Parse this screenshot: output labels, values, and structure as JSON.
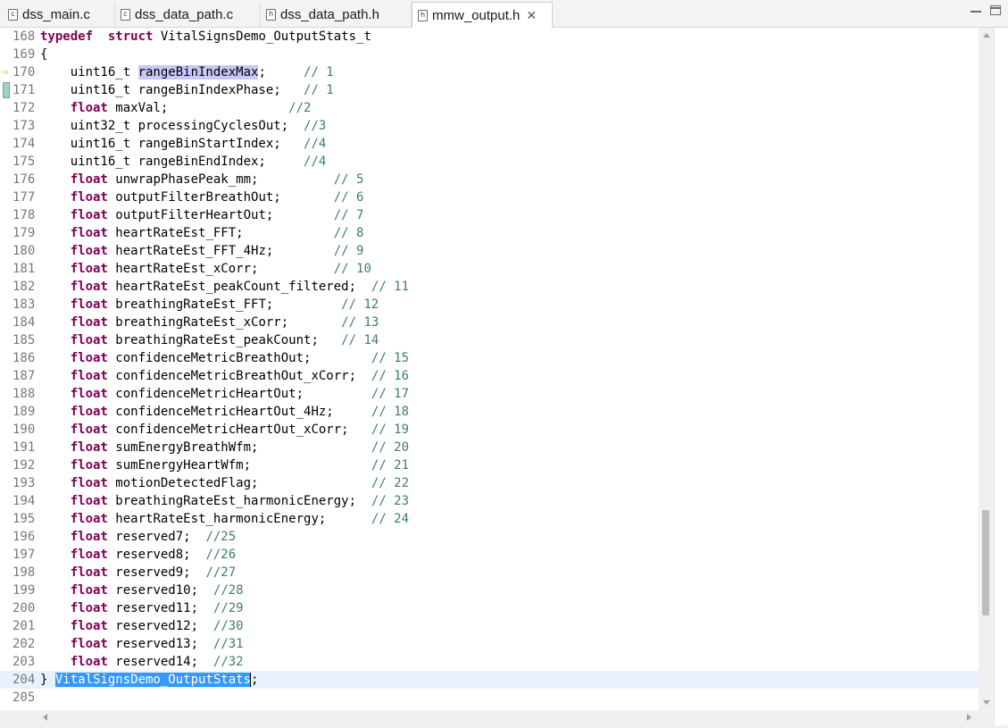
{
  "tabs": [
    {
      "label": "dss_main.c",
      "icon": "c-file-icon",
      "glyph": "c",
      "active": false
    },
    {
      "label": "dss_data_path.c",
      "icon": "c-file-icon",
      "glyph": "c",
      "active": false
    },
    {
      "label": "dss_data_path.h",
      "icon": "h-file-icon",
      "glyph": "h",
      "active": false
    },
    {
      "label": "mmw_output.h",
      "icon": "h-file-icon",
      "glyph": "h",
      "active": true,
      "close": "✕"
    }
  ],
  "editor": {
    "lines": [
      {
        "num": "168",
        "segs": [
          [
            "kw",
            "typedef"
          ],
          [
            "",
            "  "
          ],
          [
            "kw",
            "struct"
          ],
          [
            "",
            " VitalSignsDemo_OutputStats_t"
          ]
        ]
      },
      {
        "num": "169",
        "segs": [
          [
            "",
            "{"
          ]
        ]
      },
      {
        "num": "170",
        "marker": "arrow",
        "segs": [
          [
            "",
            "    uint16_t "
          ],
          [
            "occ",
            "rangeBinIndexMax"
          ],
          [
            "",
            ";     "
          ],
          [
            "cm",
            "// 1"
          ]
        ]
      },
      {
        "num": "171",
        "marker": "change",
        "segs": [
          [
            "",
            "    uint16_t rangeBinIndexPhase;   "
          ],
          [
            "cm",
            "// 1"
          ]
        ]
      },
      {
        "num": "172",
        "segs": [
          [
            "",
            "    "
          ],
          [
            "kw",
            "float"
          ],
          [
            "",
            " maxVal;                "
          ],
          [
            "cm",
            "//2"
          ]
        ]
      },
      {
        "num": "173",
        "segs": [
          [
            "",
            "    uint32_t processingCyclesOut;  "
          ],
          [
            "cm",
            "//3"
          ]
        ]
      },
      {
        "num": "174",
        "segs": [
          [
            "",
            "    uint16_t rangeBinStartIndex;   "
          ],
          [
            "cm",
            "//4"
          ]
        ]
      },
      {
        "num": "175",
        "segs": [
          [
            "",
            "    uint16_t rangeBinEndIndex;     "
          ],
          [
            "cm",
            "//4"
          ]
        ]
      },
      {
        "num": "176",
        "segs": [
          [
            "",
            "    "
          ],
          [
            "kw",
            "float"
          ],
          [
            "",
            " unwrapPhasePeak_mm;          "
          ],
          [
            "cm",
            "// 5"
          ]
        ]
      },
      {
        "num": "177",
        "segs": [
          [
            "",
            "    "
          ],
          [
            "kw",
            "float"
          ],
          [
            "",
            " outputFilterBreathOut;       "
          ],
          [
            "cm",
            "// 6"
          ]
        ]
      },
      {
        "num": "178",
        "segs": [
          [
            "",
            "    "
          ],
          [
            "kw",
            "float"
          ],
          [
            "",
            " outputFilterHeartOut;        "
          ],
          [
            "cm",
            "// 7"
          ]
        ]
      },
      {
        "num": "179",
        "segs": [
          [
            "",
            "    "
          ],
          [
            "kw",
            "float"
          ],
          [
            "",
            " heartRateEst_FFT;            "
          ],
          [
            "cm",
            "// 8"
          ]
        ]
      },
      {
        "num": "180",
        "segs": [
          [
            "",
            "    "
          ],
          [
            "kw",
            "float"
          ],
          [
            "",
            " heartRateEst_FFT_4Hz;        "
          ],
          [
            "cm",
            "// 9"
          ]
        ]
      },
      {
        "num": "181",
        "segs": [
          [
            "",
            "    "
          ],
          [
            "kw",
            "float"
          ],
          [
            "",
            " heartRateEst_xCorr;          "
          ],
          [
            "cm",
            "// 10"
          ]
        ]
      },
      {
        "num": "182",
        "segs": [
          [
            "",
            "    "
          ],
          [
            "kw",
            "float"
          ],
          [
            "",
            " heartRateEst_peakCount_filtered;  "
          ],
          [
            "cm",
            "// 11"
          ]
        ]
      },
      {
        "num": "183",
        "segs": [
          [
            "",
            "    "
          ],
          [
            "kw",
            "float"
          ],
          [
            "",
            " breathingRateEst_FFT;         "
          ],
          [
            "cm",
            "// 12"
          ]
        ]
      },
      {
        "num": "184",
        "segs": [
          [
            "",
            "    "
          ],
          [
            "kw",
            "float"
          ],
          [
            "",
            " breathingRateEst_xCorr;       "
          ],
          [
            "cm",
            "// 13"
          ]
        ]
      },
      {
        "num": "185",
        "segs": [
          [
            "",
            "    "
          ],
          [
            "kw",
            "float"
          ],
          [
            "",
            " breathingRateEst_peakCount;   "
          ],
          [
            "cm",
            "// 14"
          ]
        ]
      },
      {
        "num": "186",
        "segs": [
          [
            "",
            "    "
          ],
          [
            "kw",
            "float"
          ],
          [
            "",
            " confidenceMetricBreathOut;        "
          ],
          [
            "cm",
            "// 15"
          ]
        ]
      },
      {
        "num": "187",
        "segs": [
          [
            "",
            "    "
          ],
          [
            "kw",
            "float"
          ],
          [
            "",
            " confidenceMetricBreathOut_xCorr;  "
          ],
          [
            "cm",
            "// 16"
          ]
        ]
      },
      {
        "num": "188",
        "segs": [
          [
            "",
            "    "
          ],
          [
            "kw",
            "float"
          ],
          [
            "",
            " confidenceMetricHeartOut;         "
          ],
          [
            "cm",
            "// 17"
          ]
        ]
      },
      {
        "num": "189",
        "segs": [
          [
            "",
            "    "
          ],
          [
            "kw",
            "float"
          ],
          [
            "",
            " confidenceMetricHeartOut_4Hz;     "
          ],
          [
            "cm",
            "// 18"
          ]
        ]
      },
      {
        "num": "190",
        "segs": [
          [
            "",
            "    "
          ],
          [
            "kw",
            "float"
          ],
          [
            "",
            " confidenceMetricHeartOut_xCorr;   "
          ],
          [
            "cm",
            "// 19"
          ]
        ]
      },
      {
        "num": "191",
        "segs": [
          [
            "",
            "    "
          ],
          [
            "kw",
            "float"
          ],
          [
            "",
            " sumEnergyBreathWfm;               "
          ],
          [
            "cm",
            "// 20"
          ]
        ]
      },
      {
        "num": "192",
        "segs": [
          [
            "",
            "    "
          ],
          [
            "kw",
            "float"
          ],
          [
            "",
            " sumEnergyHeartWfm;                "
          ],
          [
            "cm",
            "// 21"
          ]
        ]
      },
      {
        "num": "193",
        "segs": [
          [
            "",
            "    "
          ],
          [
            "kw",
            "float"
          ],
          [
            "",
            " motionDetectedFlag;               "
          ],
          [
            "cm",
            "// 22"
          ]
        ]
      },
      {
        "num": "194",
        "segs": [
          [
            "",
            "    "
          ],
          [
            "kw",
            "float"
          ],
          [
            "",
            " breathingRateEst_harmonicEnergy;  "
          ],
          [
            "cm",
            "// 23"
          ]
        ]
      },
      {
        "num": "195",
        "segs": [
          [
            "",
            "    "
          ],
          [
            "kw",
            "float"
          ],
          [
            "",
            " heartRateEst_harmonicEnergy;      "
          ],
          [
            "cm",
            "// 24"
          ]
        ]
      },
      {
        "num": "196",
        "segs": [
          [
            "",
            "    "
          ],
          [
            "kw",
            "float"
          ],
          [
            "",
            " reserved7;  "
          ],
          [
            "cm",
            "//25"
          ]
        ]
      },
      {
        "num": "197",
        "segs": [
          [
            "",
            "    "
          ],
          [
            "kw",
            "float"
          ],
          [
            "",
            " reserved8;  "
          ],
          [
            "cm",
            "//26"
          ]
        ]
      },
      {
        "num": "198",
        "segs": [
          [
            "",
            "    "
          ],
          [
            "kw",
            "float"
          ],
          [
            "",
            " reserved9;  "
          ],
          [
            "cm",
            "//27"
          ]
        ]
      },
      {
        "num": "199",
        "segs": [
          [
            "",
            "    "
          ],
          [
            "kw",
            "float"
          ],
          [
            "",
            " reserved10;  "
          ],
          [
            "cm",
            "//28"
          ]
        ]
      },
      {
        "num": "200",
        "segs": [
          [
            "",
            "    "
          ],
          [
            "kw",
            "float"
          ],
          [
            "",
            " reserved11;  "
          ],
          [
            "cm",
            "//29"
          ]
        ]
      },
      {
        "num": "201",
        "segs": [
          [
            "",
            "    "
          ],
          [
            "kw",
            "float"
          ],
          [
            "",
            " reserved12;  "
          ],
          [
            "cm",
            "//30"
          ]
        ]
      },
      {
        "num": "202",
        "segs": [
          [
            "",
            "    "
          ],
          [
            "kw",
            "float"
          ],
          [
            "",
            " reserved13;  "
          ],
          [
            "cm",
            "//31"
          ]
        ]
      },
      {
        "num": "203",
        "segs": [
          [
            "",
            "    "
          ],
          [
            "kw",
            "float"
          ],
          [
            "",
            " reserved14;  "
          ],
          [
            "cm",
            "//32"
          ]
        ]
      },
      {
        "num": "204",
        "current": true,
        "segs": [
          [
            "",
            "} "
          ],
          [
            "sel",
            "VitalSignsDemo_OutputStats"
          ],
          [
            "caret",
            ""
          ],
          [
            "",
            ";"
          ]
        ]
      },
      {
        "num": "205",
        "segs": []
      }
    ]
  },
  "colors": {
    "keyword": "#7f0055",
    "comment": "#3f7f5f",
    "selection": "#3399ff",
    "current_line": "#e8f2fe",
    "occurrence": "#c8c8f8"
  },
  "window_controls": {
    "minimize_icon": "minimize-icon",
    "maximize_icon": "maximize-icon"
  }
}
